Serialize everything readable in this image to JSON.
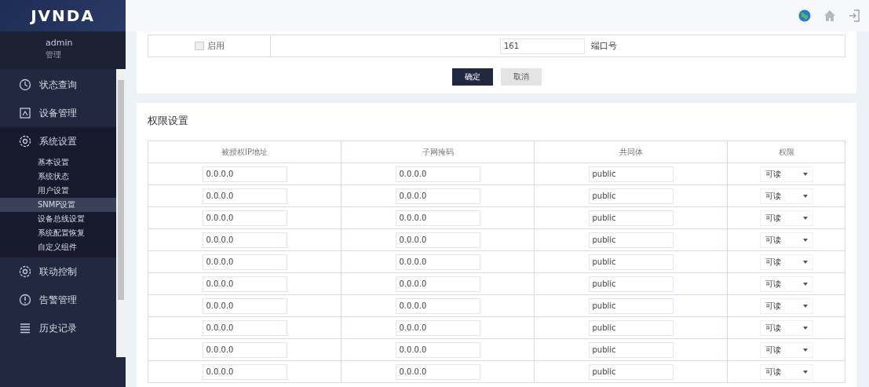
{
  "logo": "JVNDA",
  "user": {
    "name": "admin",
    "role": "管理"
  },
  "sidebar": {
    "items": [
      {
        "label": "状态查询",
        "kind": "clock",
        "expanded": false
      },
      {
        "label": "设备管理",
        "kind": "device",
        "expanded": false
      },
      {
        "label": "系统设置",
        "kind": "gear",
        "expanded": true,
        "children": [
          {
            "label": "基本设置",
            "selected": false
          },
          {
            "label": "系统状态",
            "selected": false
          },
          {
            "label": "用户设置",
            "selected": false
          },
          {
            "label": "SNMP设置",
            "selected": true
          },
          {
            "label": "设备总线设置",
            "selected": false
          },
          {
            "label": "系统配置恢复",
            "selected": false
          },
          {
            "label": "自定义组件",
            "selected": false
          }
        ]
      },
      {
        "label": "联动控制",
        "kind": "gear",
        "expanded": false
      },
      {
        "label": "告警管理",
        "kind": "alert",
        "expanded": false
      },
      {
        "label": "历史记录",
        "kind": "list",
        "expanded": false
      }
    ]
  },
  "trap_row": {
    "checkbox_label": "启用",
    "checked": false,
    "port_value": "161",
    "port_label": "端口号"
  },
  "buttons": [
    {
      "label": "确定",
      "kind": "primary"
    },
    {
      "label": "取消",
      "kind": "secondary"
    }
  ],
  "permissions": {
    "title": "权限设置",
    "columns": [
      "被授权IP地址",
      "子网掩码",
      "共同体",
      "权限"
    ],
    "rows": [
      {
        "ip": "0.0.0.0",
        "mask": "0.0.0.0",
        "community": "public",
        "access": "可读"
      },
      {
        "ip": "0.0.0.0",
        "mask": "0.0.0.0",
        "community": "public",
        "access": "可读"
      },
      {
        "ip": "0.0.0.0",
        "mask": "0.0.0.0",
        "community": "public",
        "access": "可读"
      },
      {
        "ip": "0.0.0.0",
        "mask": "0.0.0.0",
        "community": "public",
        "access": "可读"
      },
      {
        "ip": "0.0.0.0",
        "mask": "0.0.0.0",
        "community": "public",
        "access": "可读"
      },
      {
        "ip": "0.0.0.0",
        "mask": "0.0.0.0",
        "community": "public",
        "access": "可读"
      },
      {
        "ip": "0.0.0.0",
        "mask": "0.0.0.0",
        "community": "public",
        "access": "可读"
      },
      {
        "ip": "0.0.0.0",
        "mask": "0.0.0.0",
        "community": "public",
        "access": "可读"
      },
      {
        "ip": "0.0.0.0",
        "mask": "0.0.0.0",
        "community": "public",
        "access": "可读"
      },
      {
        "ip": "0.0.0.0",
        "mask": "0.0.0.0",
        "community": "public",
        "access": "可读"
      }
    ]
  }
}
